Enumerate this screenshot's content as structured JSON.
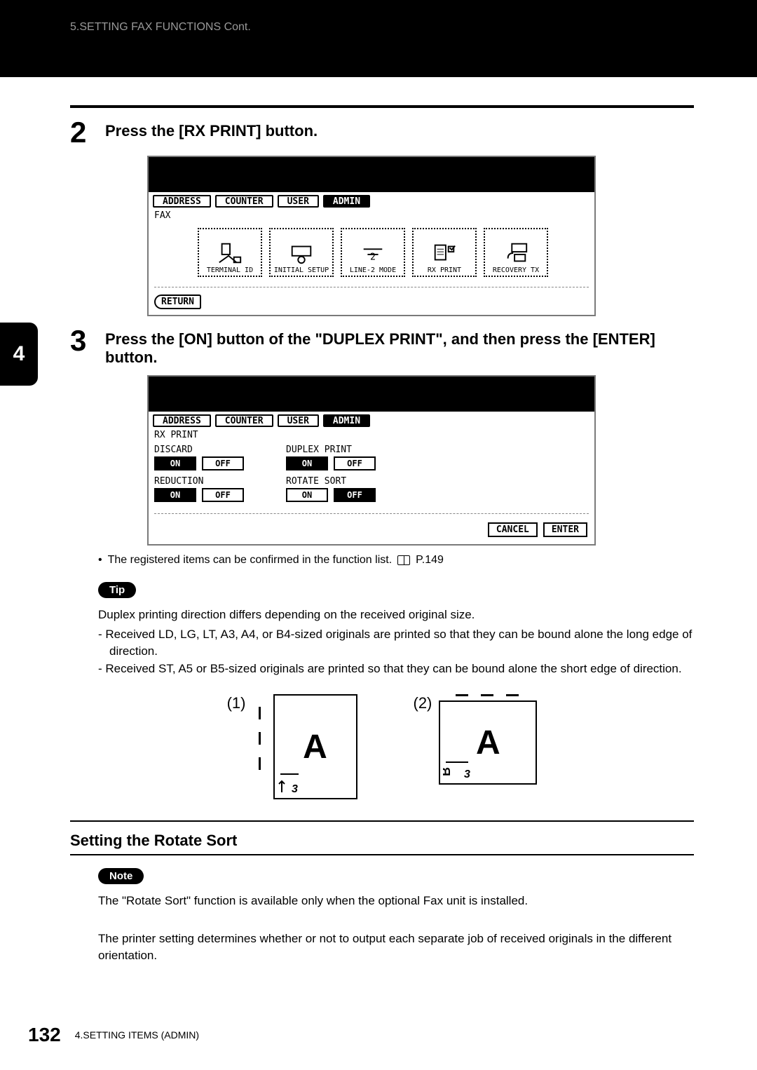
{
  "header": {
    "breadcrumb": "5.SETTING FAX FUNCTIONS Cont."
  },
  "side_tab": "4",
  "steps": {
    "s2": {
      "num": "2",
      "text": "Press the [RX PRINT] button."
    },
    "s3": {
      "num": "3",
      "text": "Press the [ON] button of the \"DUPLEX PRINT\", and then press the [ENTER] button."
    }
  },
  "screen1": {
    "tabs": [
      "ADDRESS",
      "COUNTER",
      "USER",
      "ADMIN"
    ],
    "sub": "FAX",
    "buttons": [
      "TERMINAL ID",
      "INITIAL SETUP",
      "LINE-2 MODE",
      "RX PRINT",
      "RECOVERY TX"
    ],
    "return": "RETURN"
  },
  "screen2": {
    "tabs": [
      "ADDRESS",
      "COUNTER",
      "USER",
      "ADMIN"
    ],
    "sub": "RX PRINT",
    "left": {
      "g1": {
        "label": "DISCARD",
        "on": "ON",
        "off": "OFF"
      },
      "g2": {
        "label": "REDUCTION",
        "on": "ON",
        "off": "OFF"
      }
    },
    "right": {
      "g1": {
        "label": "DUPLEX PRINT",
        "on": "ON",
        "off": "OFF"
      },
      "g2": {
        "label": "ROTATE SORT",
        "on": "ON",
        "off": "OFF"
      }
    },
    "cancel": "CANCEL",
    "enter": "ENTER"
  },
  "note_line": {
    "text": "The registered items can be confirmed in the function list.",
    "ref": "P.149"
  },
  "tip": {
    "label": "Tip",
    "intro": "Duplex printing direction differs depending on the received original size.",
    "d1": "Received LD, LG, LT, A3, A4, or B4-sized originals are printed so that they can be bound alone the long edge of direction.",
    "d2": "Received ST, A5 or B5-sized originals are printed so that they can be bound alone the short edge of direction."
  },
  "diagram": {
    "l1": "(1)",
    "l2": "(2)",
    "glyph": "A"
  },
  "section2": {
    "title": "Setting the Rotate Sort",
    "note_label": "Note",
    "note_text": "The \"Rotate Sort\" function is available only when the optional Fax unit is installed.",
    "body": "The printer setting determines whether or not to output each separate job of received originals in the different orientation."
  },
  "footer": {
    "page": "132",
    "text": "4.SETTING ITEMS (ADMIN)"
  }
}
